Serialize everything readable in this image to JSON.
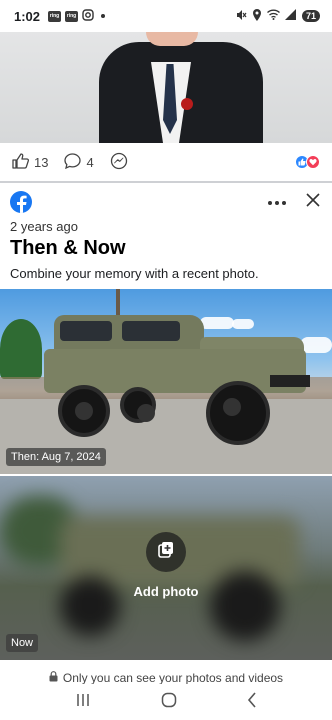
{
  "status_bar": {
    "time": "1:02",
    "notification_icons": [
      "ring-icon",
      "ring-icon",
      "instagram-icon"
    ],
    "battery_level": "71"
  },
  "reactions": {
    "like_count": "13",
    "comment_count": "4"
  },
  "memory": {
    "time_ago": "2 years ago",
    "title": "Then & Now",
    "subtitle": "Combine your memory with a recent photo."
  },
  "then_photo": {
    "label": "Then: Aug 7, 2024"
  },
  "now_photo": {
    "label": "Now",
    "add_photo_label": "Add photo"
  },
  "privacy": {
    "text": "Only you can see your photos and videos"
  },
  "colors": {
    "facebook_blue": "#1877f2",
    "like_blue": "#2d88ff",
    "love_red": "#f33e58"
  }
}
